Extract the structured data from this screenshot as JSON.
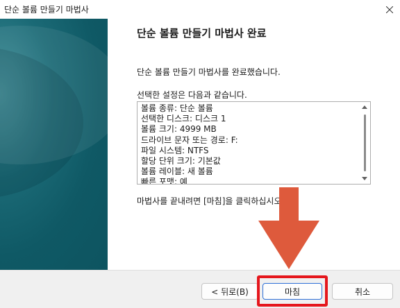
{
  "window": {
    "title": "단순 볼륨 만들기 마법사"
  },
  "page": {
    "heading": "단순 볼륨 만들기 마법사 완료",
    "description": "단순 볼륨 만들기 마법사를 완료했습니다.",
    "settings_label": "선택한 설정은 다음과 같습니다.",
    "settings": [
      "볼륨 종류: 단순 볼륨",
      "선택한 디스크: 디스크 1",
      "볼륨 크기: 4999 MB",
      "드라이브 문자 또는 경로: F:",
      "파일 시스템: NTFS",
      "할당 단위 크기: 기본값",
      "볼륨 레이블: 새 볼륨",
      "빠른 포맷: 예"
    ],
    "finish_hint": "마법사를 끝내려면 [마침]을 클릭하십시오."
  },
  "buttons": {
    "back": "< 뒤로(B)",
    "finish": "마침",
    "cancel": "취소"
  },
  "annotation": {
    "arrow_color": "#de5a3c",
    "highlight_color": "#e5161c"
  }
}
